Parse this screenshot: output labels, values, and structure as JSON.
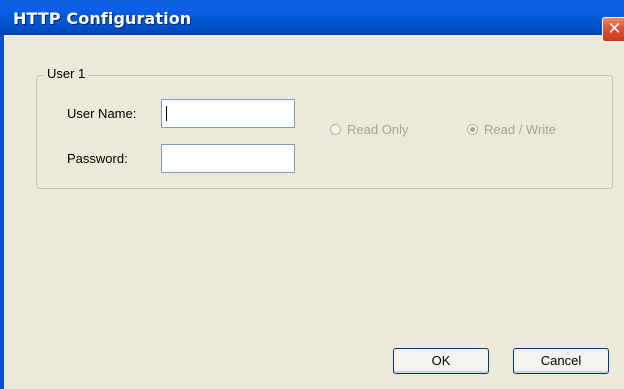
{
  "window": {
    "title": "HTTP Configuration",
    "close_glyph": "✕"
  },
  "group": {
    "label": "User 1"
  },
  "fields": {
    "username_label": "User Name:",
    "username_value": "",
    "password_label": "Password:",
    "password_value": ""
  },
  "access": {
    "read_only_label": "Read Only",
    "read_write_label": "Read / Write",
    "selected": "Read / Write",
    "enabled": false
  },
  "buttons": {
    "ok_label": "OK",
    "cancel_label": "Cancel"
  },
  "colors": {
    "titlebar": "#0058d4",
    "dialog_bg": "#ece9d8",
    "disabled_text": "#a7a496",
    "close_button": "#e0553a"
  }
}
